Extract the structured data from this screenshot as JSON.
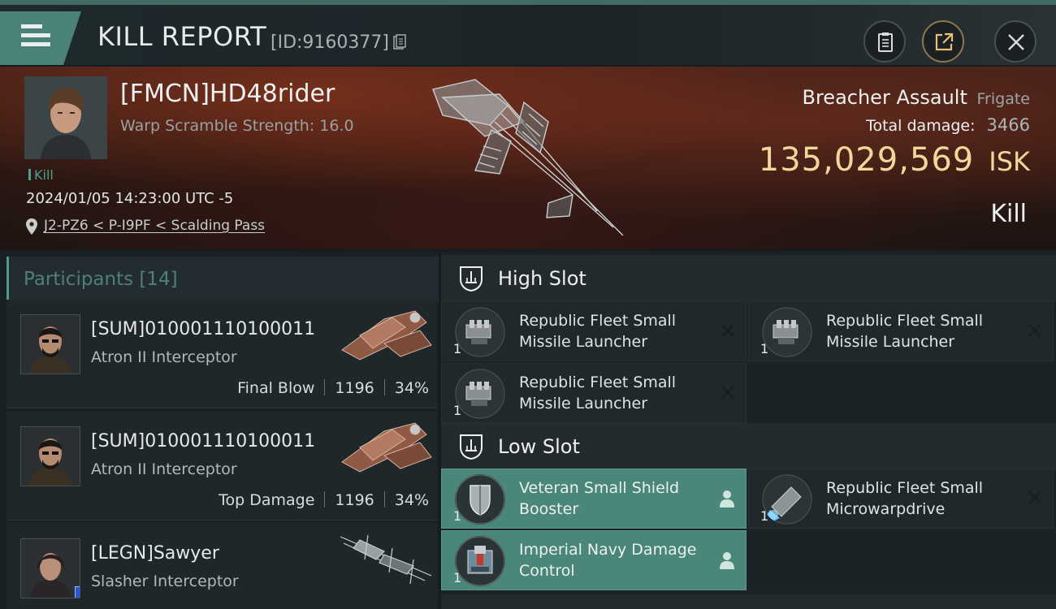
{
  "header": {
    "title": "KILL REPORT",
    "report_id": "[ID:9160377]"
  },
  "victim": {
    "name": "[FMCN]HD48rider",
    "stat_line": "Warp Scramble Strength: 16.0",
    "tag": "Kill",
    "datetime": "2024/01/05 14:23:00 UTC -5",
    "location": "J2-PZ6 < P-I9PF < Scalding Pass",
    "ship_name": "Breacher Assault",
    "ship_class": "Frigate",
    "total_damage_label": "Total damage:",
    "total_damage": "3466",
    "isk_value": "135,029,569",
    "isk_unit": "ISK",
    "result": "Kill"
  },
  "participants": {
    "heading": "Participants [14]",
    "rows": [
      {
        "name": "[SUM]010001110100011",
        "ship": "Atron II Interceptor",
        "role": "Final Blow",
        "damage": "1196",
        "percent": "34%"
      },
      {
        "name": "[SUM]010001110100011",
        "ship": "Atron II Interceptor",
        "role": "Top Damage",
        "damage": "1196",
        "percent": "34%"
      },
      {
        "name": "[LEGN]Sawyer",
        "ship": "Slasher Interceptor"
      }
    ]
  },
  "fitting": {
    "high_slot": {
      "label": "High Slot",
      "items": [
        {
          "name": "Republic Fleet Small Missile Launcher",
          "qty": "1"
        },
        {
          "name": "Republic Fleet Small Missile Launcher",
          "qty": "1"
        },
        {
          "name": "Republic Fleet Small Missile Launcher",
          "qty": "1"
        }
      ]
    },
    "low_slot": {
      "label": "Low Slot",
      "items": [
        {
          "name": "Veteran Small Shield Booster",
          "qty": "1"
        },
        {
          "name": "Republic Fleet Small Microwarpdrive",
          "qty": "1"
        },
        {
          "name": "Imperial Navy Damage Control",
          "qty": "1"
        }
      ]
    }
  },
  "colors": {
    "accent_teal": "#4a8279",
    "isk_gold": "#f0d79a",
    "banner_red": "#3e1f18"
  },
  "icons": [
    "menu-icon",
    "copy-icon",
    "clipboard-icon",
    "share-icon",
    "close-icon",
    "location-pin-icon",
    "x-icon",
    "pilot-icon",
    "slot-icon"
  ]
}
